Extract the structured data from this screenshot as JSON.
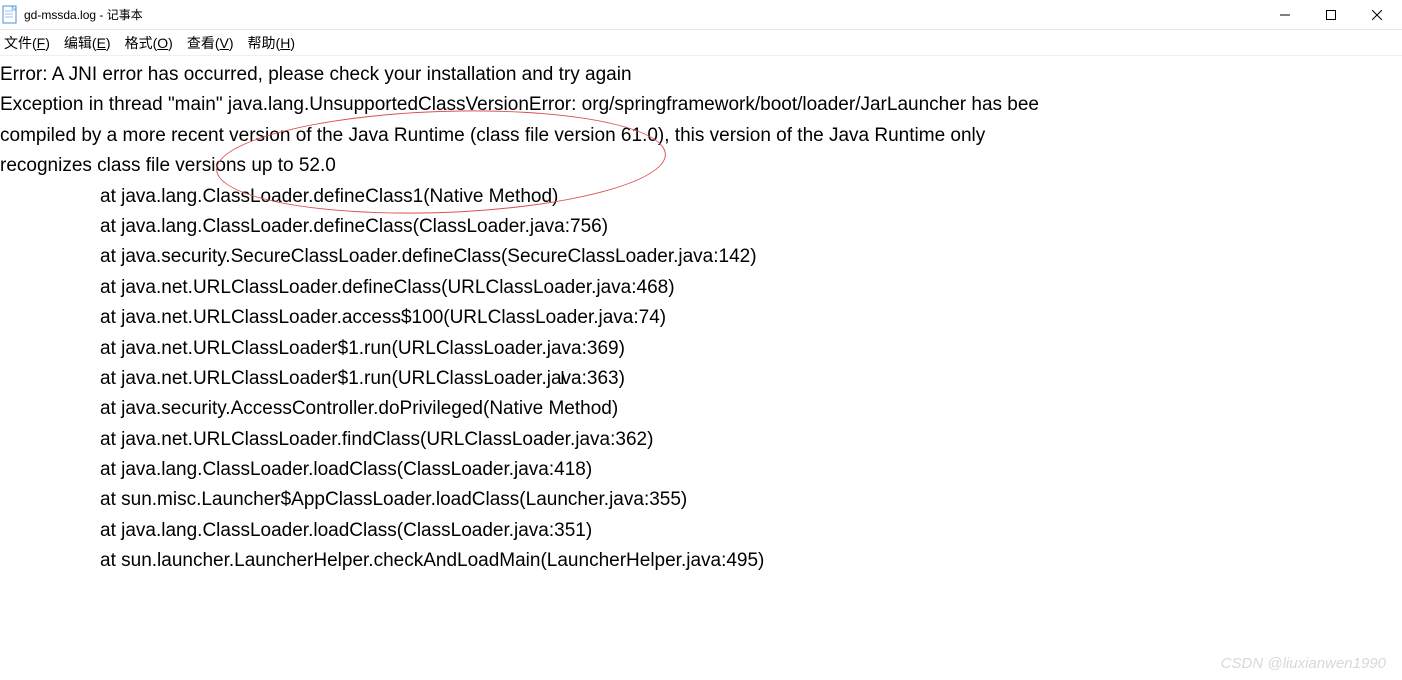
{
  "titlebar": {
    "icon_name": "notepad-icon",
    "title": "gd-mssda.log - 记事本"
  },
  "menu": {
    "file": "文件(F)",
    "edit": "编辑(E)",
    "format": "格式(O)",
    "view": "查看(V)",
    "help": "帮助(H)"
  },
  "log": {
    "line1": "Error: A JNI error has occurred, please check your installation and try again",
    "line2": "Exception in thread \"main\" java.lang.UnsupportedClassVersionError: org/springframework/boot/loader/JarLauncher has bee",
    "line3": "compiled by a more recent version of the Java Runtime (class file version 61.0), this version of the Java Runtime only",
    "line4": "recognizes class file versions up to 52.0",
    "stack": [
      "at java.lang.ClassLoader.defineClass1(Native Method)",
      "at java.lang.ClassLoader.defineClass(ClassLoader.java:756)",
      "at java.security.SecureClassLoader.defineClass(SecureClassLoader.java:142)",
      "at java.net.URLClassLoader.defineClass(URLClassLoader.java:468)",
      "at java.net.URLClassLoader.access$100(URLClassLoader.java:74)",
      "at java.net.URLClassLoader$1.run(URLClassLoader.java:369)",
      "at java.net.URLClassLoader$1.run(URLClassLoader.java:363)",
      "at java.security.AccessController.doPrivileged(Native Method)",
      "at java.net.URLClassLoader.findClass(URLClassLoader.java:362)",
      "at java.lang.ClassLoader.loadClass(ClassLoader.java:418)",
      "at sun.misc.Launcher$AppClassLoader.loadClass(Launcher.java:355)",
      "at java.lang.ClassLoader.loadClass(ClassLoader.java:351)",
      "at sun.launcher.LauncherHelper.checkAndLoadMain(LauncherHelper.java:495)"
    ]
  },
  "watermark": "CSDN @liuxianwen1990"
}
